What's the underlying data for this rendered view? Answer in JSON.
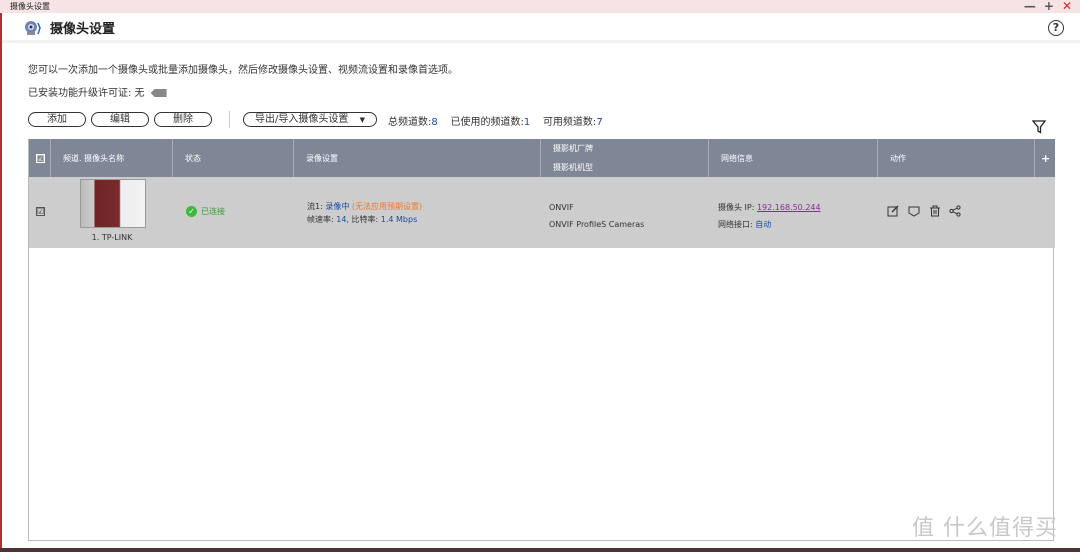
{
  "window": {
    "title": "摄像头设置",
    "minimize": "—",
    "maximize": "+",
    "close": "✕"
  },
  "header": {
    "title": "摄像头设置",
    "help": "?"
  },
  "description": "您可以一次添加一个摄像头或批量添加摄像头，然后修改摄像头设置、视频流设置和录像首选项。",
  "license": "已安装功能升级许可证: 无",
  "toolbar": {
    "add": "添加",
    "edit": "编辑",
    "delete": "删除",
    "export_import": "导出/导入摄像头设置",
    "total_label": "总频道数:",
    "total": "8",
    "used_label": "已使用的频道数:",
    "used": "1",
    "available_label": "可用频道数:",
    "available": "7"
  },
  "table": {
    "headers": {
      "check": "☑",
      "name": "频道. 摄像头名称",
      "status": "状态",
      "record": "录像设置",
      "vendor": "摄影机厂牌",
      "model": "摄影机机型",
      "network": "网络信息",
      "action": "动作",
      "add": "+"
    },
    "rows": [
      {
        "check": "☑",
        "name": "1. TP-LINK",
        "status": "已连接",
        "stream_label": "流1:",
        "stream_state": "录像中",
        "stream_warn": "(无法应用预期设置)",
        "fps_label": "帧速率:",
        "fps": "14",
        "bitrate_label": ", 比特率:",
        "bitrate": "1.4 Mbps",
        "vendor": "ONVIF",
        "model": "ONVIF ProfileS Cameras",
        "ip_label": "摄像头 IP:",
        "ip": "192.168.50.244",
        "iface_label": "网络接口:",
        "iface": "自动"
      }
    ]
  },
  "watermark": "值 什么值得买"
}
